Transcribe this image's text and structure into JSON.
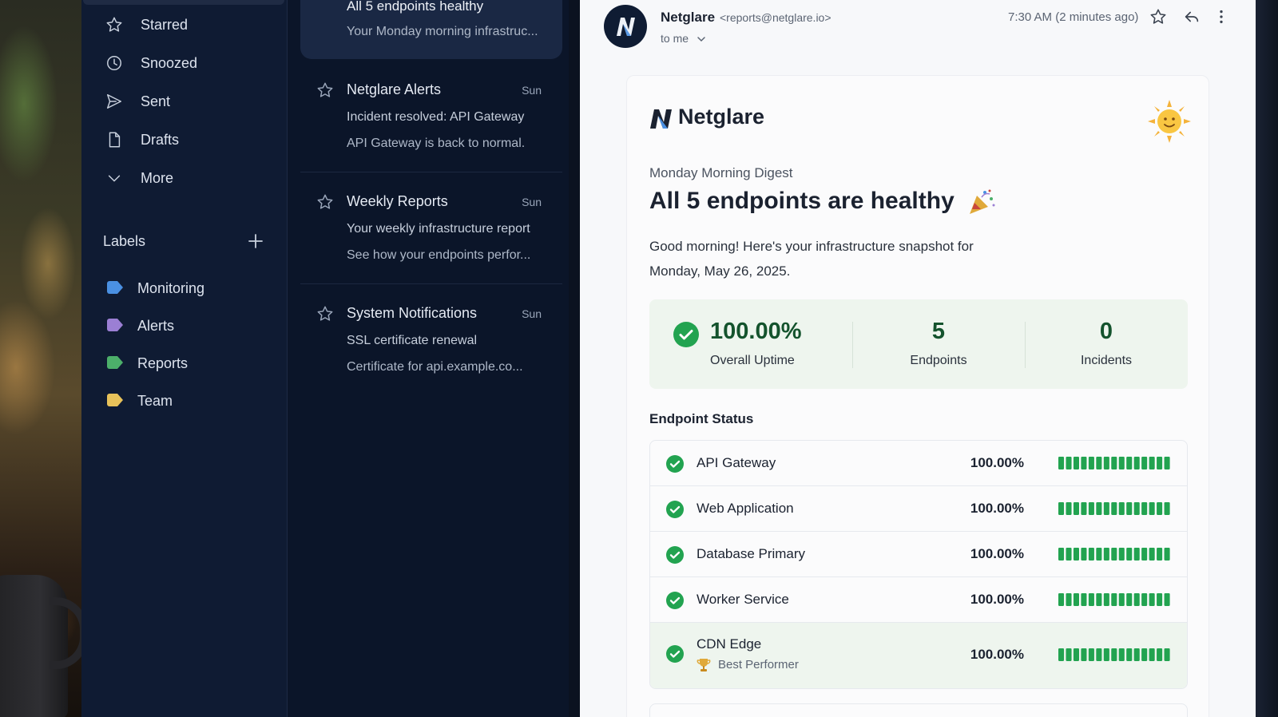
{
  "sidebar": {
    "nav": [
      {
        "label": "Starred",
        "icon": "star-icon"
      },
      {
        "label": "Snoozed",
        "icon": "clock-icon"
      },
      {
        "label": "Sent",
        "icon": "send-icon"
      },
      {
        "label": "Drafts",
        "icon": "draft-icon"
      },
      {
        "label": "More",
        "icon": "chevron-down-icon"
      }
    ],
    "labels_title": "Labels",
    "labels": [
      {
        "label": "Monitoring",
        "color": "#4a90e2"
      },
      {
        "label": "Alerts",
        "color": "#9b7fd4"
      },
      {
        "label": "Reports",
        "color": "#4caf6a"
      },
      {
        "label": "Team",
        "color": "#e8c25a"
      }
    ]
  },
  "messages": [
    {
      "subject": "All 5 endpoints healthy",
      "preview": "Your Monday morning infrastruc..."
    },
    {
      "sender": "Netglare Alerts",
      "date": "Sun",
      "subject": "Incident resolved: API Gateway",
      "preview": "API Gateway is back to normal."
    },
    {
      "sender": "Weekly Reports",
      "date": "Sun",
      "subject": "Your weekly infrastructure report",
      "preview": "See how your endpoints perfor..."
    },
    {
      "sender": "System Notifications",
      "date": "Sun",
      "subject": "SSL certificate renewal",
      "preview": "Certificate for api.example.co..."
    }
  ],
  "email": {
    "from_name": "Netglare",
    "from_email": "<reports@netglare.io>",
    "to": "to me",
    "time": "7:30 AM (2 minutes ago)",
    "brand": "Netglare",
    "digest_label": "Monday Morning Digest",
    "headline": "All 5 endpoints are healthy",
    "intro": "Good morning! Here's your infrastructure snapshot for Monday, May 26, 2025.",
    "stats": {
      "uptime_value": "100.00%",
      "uptime_label": "Overall Uptime",
      "endpoints_value": "5",
      "endpoints_label": "Endpoints",
      "incidents_value": "0",
      "incidents_label": "Incidents"
    },
    "section_title": "Endpoint Status",
    "endpoints": [
      {
        "name": "API Gateway",
        "uptime": "100.00%"
      },
      {
        "name": "Web Application",
        "uptime": "100.00%"
      },
      {
        "name": "Database Primary",
        "uptime": "100.00%"
      },
      {
        "name": "Worker Service",
        "uptime": "100.00%"
      },
      {
        "name": "CDN Edge",
        "uptime": "100.00%",
        "badge": "Best Performer"
      }
    ],
    "accent_green": "#22a350",
    "uptime_bar_segments": 15
  }
}
